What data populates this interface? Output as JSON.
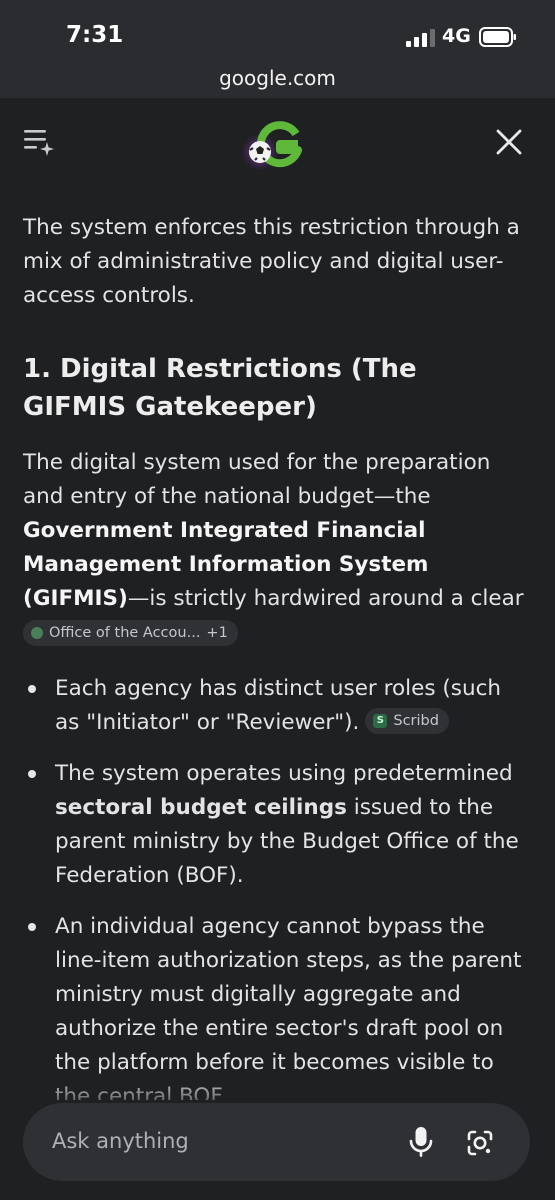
{
  "status_bar": {
    "time": "7:31",
    "network": "4G",
    "url": "google.com"
  },
  "header": {
    "menu_icon": "menu-sparkle-icon",
    "logo": "google-soccer-doodle-logo",
    "close_icon": "close-icon"
  },
  "content": {
    "intro": "The system enforces this restriction through a mix of administrative policy and digital user-access controls.",
    "heading": "1. Digital Restrictions (The GIFMIS Gatekeeper)",
    "para_pre": "The digital system used for the preparation and entry of the national budget—the ",
    "para_bold": "Government Integrated Financial Management Information System (GIFMIS)",
    "para_post": "—is strictly hardwired around a clear structural hierarchy.",
    "source_chip": {
      "label": "Office of the Accou...",
      "extra": "+1"
    },
    "bullets": [
      {
        "text": "Each agency has distinct user roles (such as \"Initiator\" or \"Reviewer\").",
        "chip": "Scribd"
      },
      {
        "pre": "The system operates using predetermined ",
        "bold": "sectoral budget ceilings",
        "post": " issued to the parent ministry by the Budget Office of the Federation (BOF)."
      },
      {
        "text": "An individual agency cannot bypass the line-item authorization steps, as the parent ministry must digitally aggregate and authorize the entire sector's draft pool on the platform before it becomes visible to the central BOF."
      }
    ]
  },
  "ask_bar": {
    "placeholder": "Ask anything",
    "mic_icon": "microphone-icon",
    "lens_icon": "google-lens-icon"
  }
}
